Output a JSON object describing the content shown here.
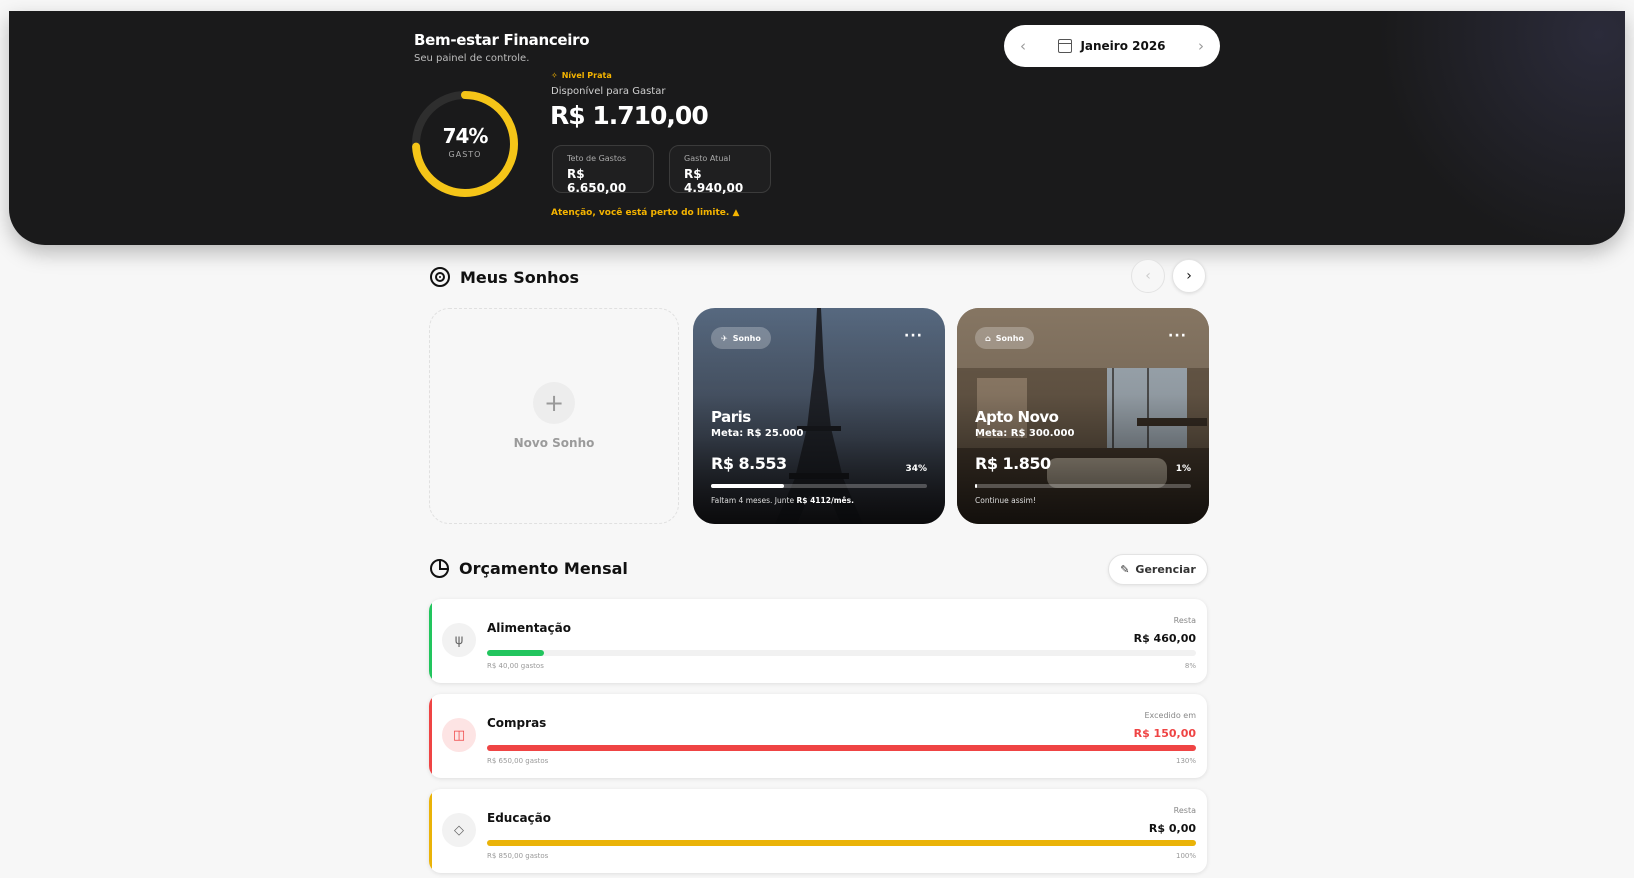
{
  "header": {
    "title": "Bem-estar Financeiro",
    "subtitle": "Seu painel de controle.",
    "month": "Janeiro 2026",
    "gauge_percent": "74%",
    "gauge_fraction": 0.74,
    "gauge_label": "GASTO",
    "level": "Nível Prata",
    "available_label": "Disponível para Gastar",
    "available_value": "R$ 1.710,00",
    "cap_label": "Teto de Gastos",
    "cap_value": "R$ 6.650,00",
    "spent_label": "Gasto Atual",
    "spent_value": "R$ 4.940,00",
    "warning": "Atenção, você está perto do limite."
  },
  "dreams": {
    "title": "Meus Sonhos",
    "new_label": "Novo Sonho",
    "items": [
      {
        "tag": "Sonho",
        "tag_icon": "plane-icon",
        "name": "Paris",
        "goal": "Meta: R$ 25.000",
        "saved": "R$ 8.553",
        "percent": "34%",
        "progress": 0.34,
        "note_prefix": "Faltam 4 meses. Junte",
        "note_amount": "R$ 4112/mês."
      },
      {
        "tag": "Sonho",
        "tag_icon": "home-icon",
        "name": "Apto Novo",
        "goal": "Meta: R$ 300.000",
        "saved": "R$ 1.850",
        "percent": "1%",
        "progress": 0.01,
        "note_prefix": "Continue assim!",
        "note_amount": ""
      }
    ]
  },
  "budget": {
    "title": "Orçamento Mensal",
    "manage_label": "Gerenciar",
    "items": [
      {
        "name": "Alimentação",
        "icon": "utensils-icon",
        "right_label": "Resta",
        "right_value": "R$ 460,00",
        "spent": "R$ 40,00 gastos",
        "percent": "8%",
        "progress": 0.08,
        "color": "#22c55e"
      },
      {
        "name": "Compras",
        "icon": "shopping-bag-icon",
        "right_label": "Excedido em",
        "right_value": "R$ 150,00",
        "spent": "R$ 650,00 gastos",
        "percent": "130%",
        "progress": 1.0,
        "color": "#ef4444"
      },
      {
        "name": "Educação",
        "icon": "graduation-cap-icon",
        "right_label": "Resta",
        "right_value": "R$ 0,00",
        "spent": "R$ 850,00 gastos",
        "percent": "100%",
        "progress": 1.0,
        "color": "#eab308"
      }
    ]
  }
}
